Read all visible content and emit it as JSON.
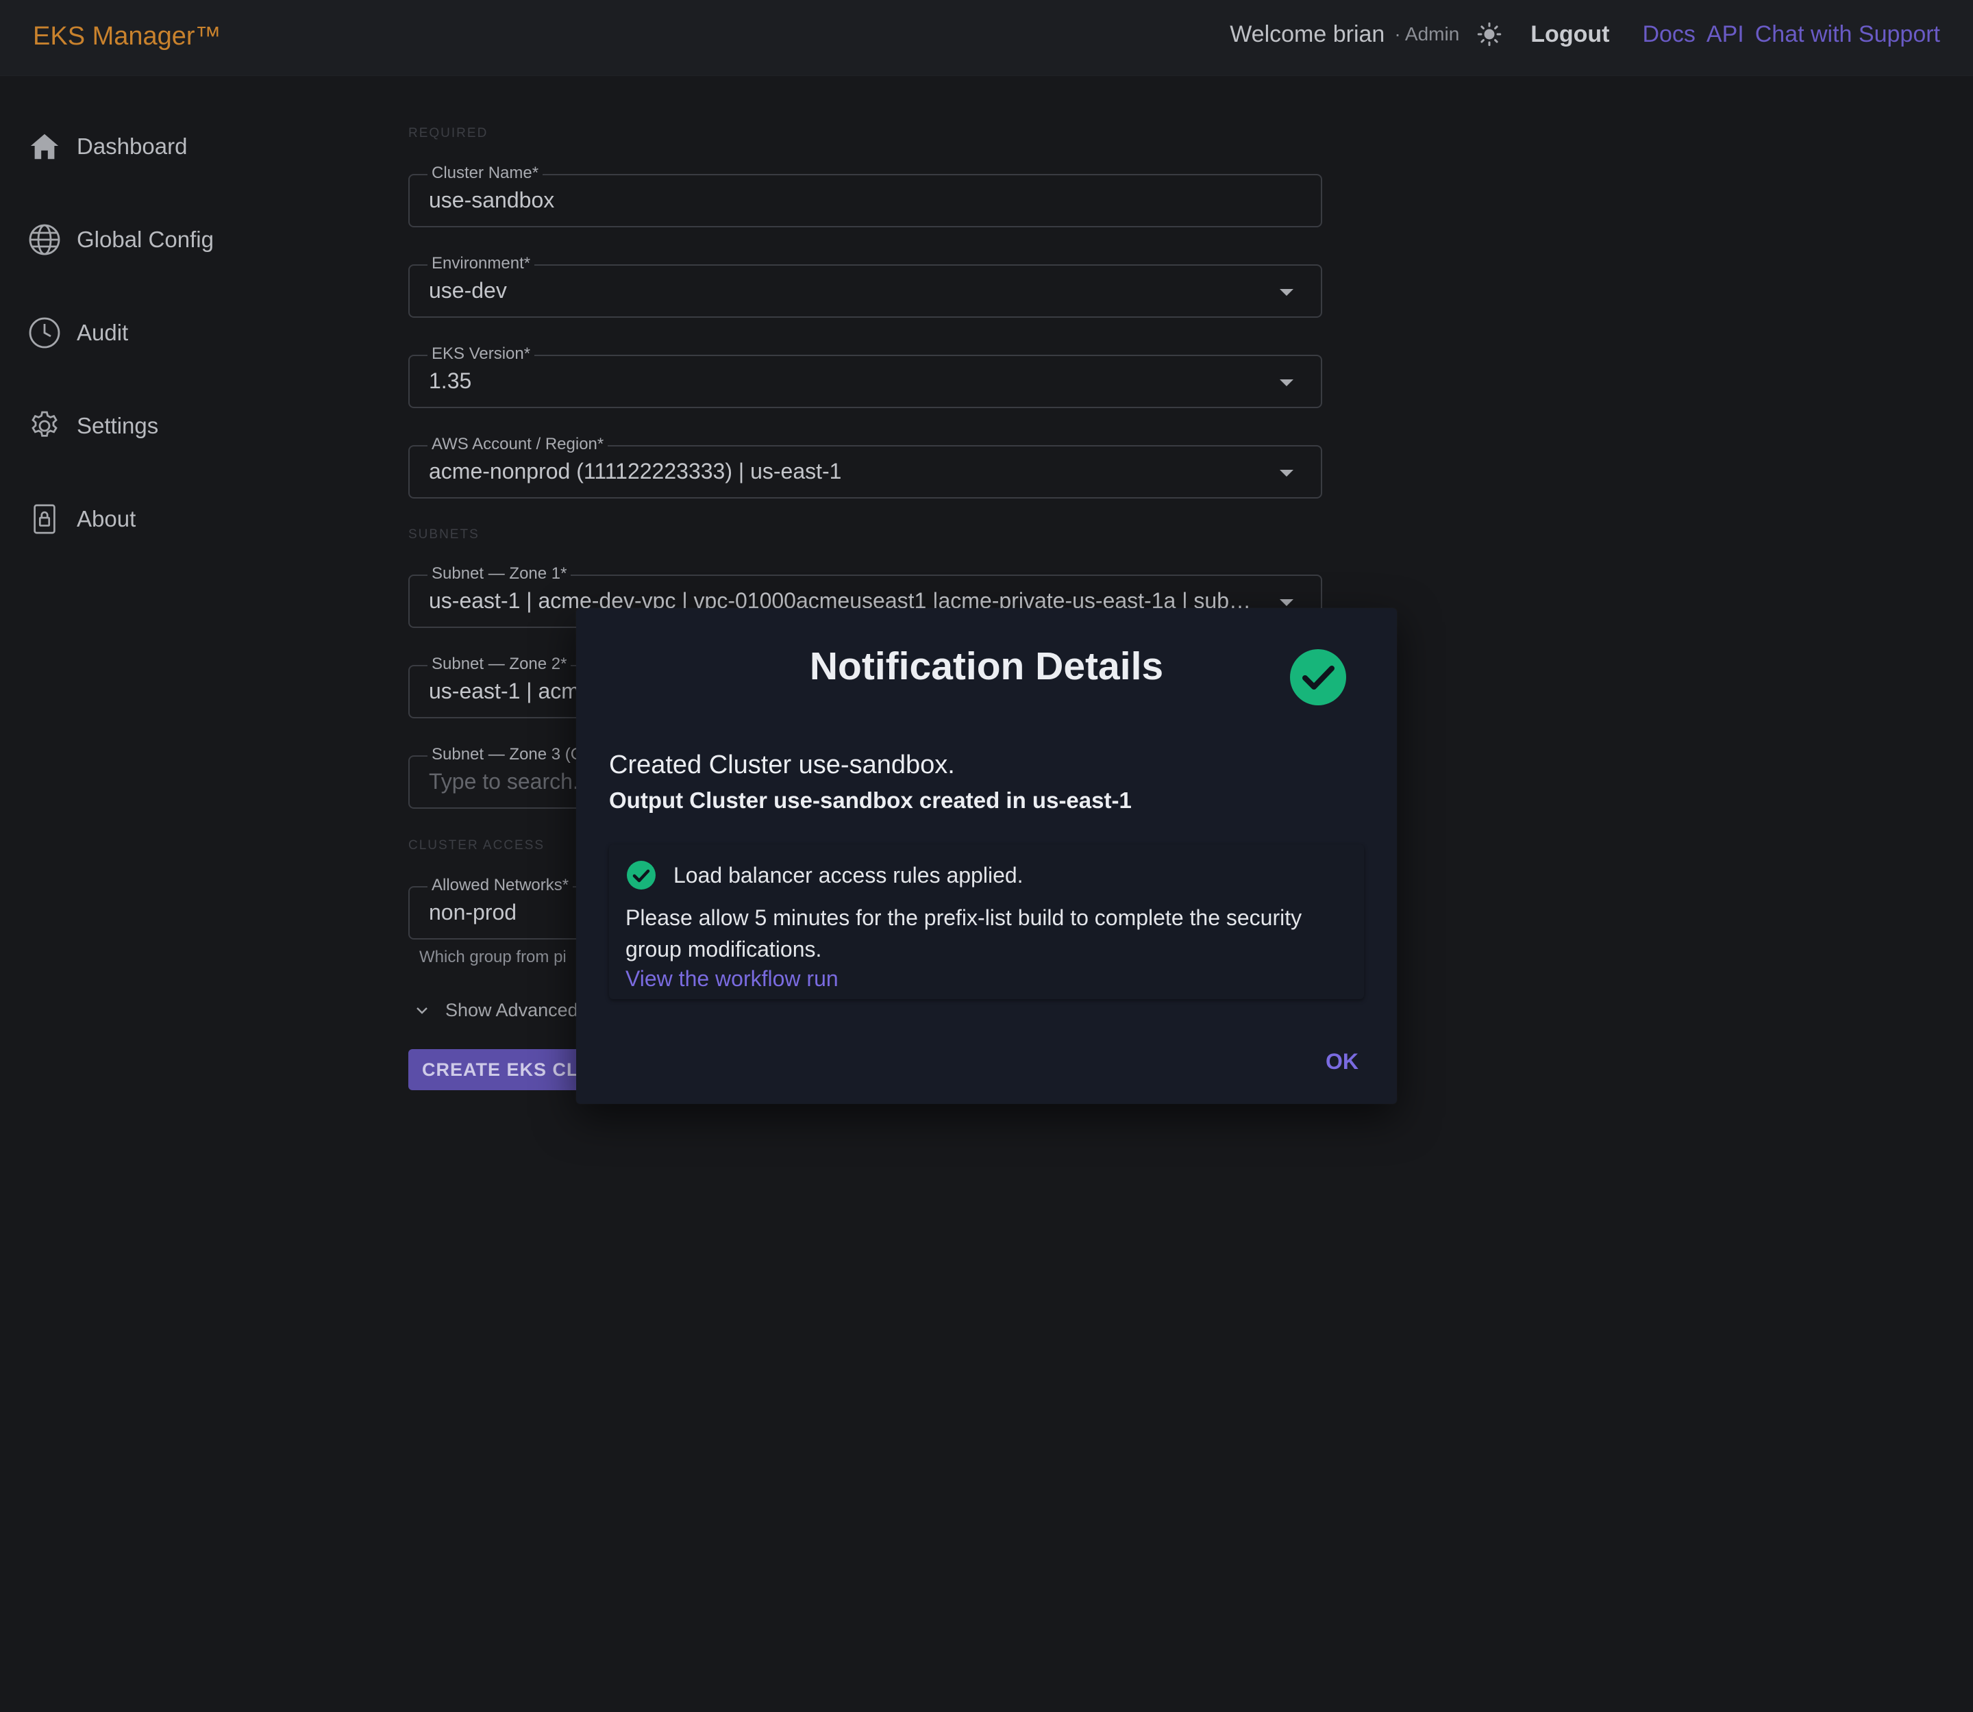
{
  "header": {
    "brand": "EKS Manager™",
    "welcome": "Welcome brian",
    "role": "· Admin",
    "logout": "Logout",
    "links": [
      "Docs",
      "API",
      "Chat with Support"
    ]
  },
  "sidebar": {
    "items": [
      {
        "label": "Dashboard",
        "icon": "home-icon"
      },
      {
        "label": "Global Config",
        "icon": "globe-icon"
      },
      {
        "label": "Audit",
        "icon": "clock-icon"
      },
      {
        "label": "Settings",
        "icon": "gear-icon"
      },
      {
        "label": "About",
        "icon": "lock-icon"
      }
    ]
  },
  "form": {
    "sections": {
      "required": "REQUIRED",
      "subnets": "SUBNETS",
      "cluster_access": "CLUSTER ACCESS"
    },
    "cluster_name": {
      "label": "Cluster Name*",
      "value": "use-sandbox"
    },
    "environment": {
      "label": "Environment*",
      "value": "use-dev"
    },
    "eks_version": {
      "label": "EKS Version*",
      "value": "1.35"
    },
    "aws_account": {
      "label": "AWS Account / Region*",
      "value": "acme-nonprod (111122223333) | us-east-1"
    },
    "subnet1": {
      "label": "Subnet — Zone 1*",
      "value": "us-east-1 | acme-dev-vpc | vpc-01000acmeuseast1 |acme-private-us-east-1a | subne..."
    },
    "subnet2": {
      "label": "Subnet — Zone 2*",
      "value": "us-east-1 | acm"
    },
    "subnet3": {
      "label": "Subnet — Zone 3 (C",
      "placeholder": "Type to search."
    },
    "allowed_networks": {
      "label": "Allowed Networks*",
      "value": "non-prod",
      "helper": "Which group from pi"
    },
    "advanced_label": "Show Advanced",
    "create_button": "CREATE EKS CLUS"
  },
  "dialog": {
    "title": "Notification Details",
    "message": "Created Cluster use-sandbox.",
    "output": "Output Cluster use-sandbox created in us-east-1",
    "status_text": "Load balancer access rules applied.",
    "body": "Please allow 5 minutes for the prefix-list build to complete the security group modifications.",
    "link": "View the workflow run",
    "ok": "OK"
  },
  "colors": {
    "accent": "#7a6be0",
    "brand": "#c9822d",
    "success": "#17b57a",
    "background": "#17181b",
    "dialog": "#171b26"
  }
}
